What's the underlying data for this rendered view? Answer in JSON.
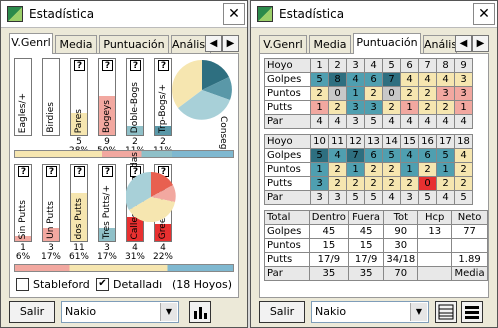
{
  "left": {
    "title": "Estadística",
    "close": "✕",
    "tabs": [
      "V.Genrl",
      "Media",
      "Puntuación",
      "Análisis"
    ],
    "upper_bars": [
      {
        "label": "Eagles/+",
        "count": "",
        "pct": "",
        "level": 0
      },
      {
        "label": "Birdies",
        "count": "",
        "pct": "",
        "level": 0
      },
      {
        "label": "Pares",
        "count": "5",
        "pct": "28%",
        "level": 0.28,
        "color": "#f6e6b0"
      },
      {
        "label": "Bogeys",
        "count": "9",
        "pct": "50%",
        "level": 0.5,
        "color": "#f2a8a0"
      },
      {
        "label": "Doble-Bogs",
        "count": "2",
        "pct": "11%",
        "level": 0.11,
        "color": "#8fc0c8"
      },
      {
        "label": "Trp-Bogs/+",
        "count": "2",
        "pct": "11%",
        "level": 0.11,
        "color": "#5a98a8"
      }
    ],
    "upper_pie_label": "Conseguido",
    "lower_bars": [
      {
        "label": "Sin Putts",
        "count": "1",
        "pct": "6%",
        "level": 0.06,
        "color": "#f2a8a0"
      },
      {
        "label": "Un Putts",
        "count": "3",
        "pct": "17%",
        "level": 0.17,
        "color": "#f2a8a0"
      },
      {
        "label": "dos Putts",
        "count": "11",
        "pct": "61%",
        "level": 0.61,
        "color": "#f6e6b0"
      },
      {
        "label": "Tres Putts/+",
        "count": "3",
        "pct": "17%",
        "level": 0.17,
        "color": "#8fc0c8"
      },
      {
        "label": "Calles Conseguidas",
        "count": "4",
        "pct": "31%",
        "level": 0.31,
        "color": "#e83030"
      },
      {
        "label": "Green en Reg.",
        "count": "4",
        "pct": "22%",
        "level": 0.22,
        "color": "#e83030"
      }
    ],
    "stableford_label": "Stableford",
    "detallado_label": "Detalladı",
    "hoyos_label": "(18 Hoyos)",
    "salir": "Salir",
    "player": "Nakio"
  },
  "right": {
    "title": "Estadística",
    "close": "✕",
    "tabs": [
      "V.Genrl",
      "Media",
      "Puntuación",
      "Análisis"
    ],
    "front": {
      "rows": [
        {
          "label": "Hoyo",
          "values": [
            "1",
            "2",
            "3",
            "4",
            "5",
            "6",
            "7",
            "8",
            "9"
          ]
        },
        {
          "label": "Golpes",
          "values": [
            "5",
            "8",
            "4",
            "6",
            "7",
            "4",
            "4",
            "4",
            "3"
          ]
        },
        {
          "label": "Puntos",
          "values": [
            "2",
            "0",
            "1",
            "2",
            "0",
            "2",
            "2",
            "3",
            "3"
          ]
        },
        {
          "label": "Putts",
          "values": [
            "1",
            "2",
            "3",
            "3",
            "2",
            "1",
            "2",
            "2",
            "1"
          ]
        },
        {
          "label": "Par",
          "values": [
            "4",
            "4",
            "3",
            "5",
            "4",
            "4",
            "4",
            "4",
            "4"
          ]
        }
      ]
    },
    "back": {
      "rows": [
        {
          "label": "Hoyo",
          "values": [
            "10",
            "11",
            "12",
            "13",
            "14",
            "15",
            "16",
            "17",
            "18"
          ]
        },
        {
          "label": "Golpes",
          "values": [
            "5",
            "4",
            "7",
            "6",
            "5",
            "4",
            "6",
            "5",
            "4"
          ]
        },
        {
          "label": "Puntos",
          "values": [
            "1",
            "2",
            "1",
            "2",
            "2",
            "1",
            "2",
            "1",
            "2"
          ]
        },
        {
          "label": "Putts",
          "values": [
            "3",
            "2",
            "2",
            "2",
            "2",
            "2",
            "0",
            "2",
            "2"
          ]
        },
        {
          "label": "Par",
          "values": [
            "3",
            "3",
            "5",
            "5",
            "4",
            "3",
            "5",
            "4",
            "5"
          ]
        }
      ]
    },
    "summary": {
      "header": [
        "Total",
        "Dentro",
        "Fuera",
        "Tot",
        "Hcp",
        "Neto"
      ],
      "rows": [
        {
          "label": "Golpes",
          "values": [
            "45",
            "45",
            "90",
            "13",
            "77"
          ]
        },
        {
          "label": "Puntos",
          "values": [
            "15",
            "15",
            "30",
            "",
            ""
          ]
        },
        {
          "label": "Putts",
          "values": [
            "17/9",
            "17/9",
            "34/18",
            "",
            "1.89"
          ]
        },
        {
          "label": "Par",
          "values": [
            "35",
            "35",
            "70",
            "",
            "Media"
          ]
        }
      ]
    },
    "salir": "Salir",
    "player": "Nakio"
  },
  "colors": {
    "score_blue": "#4f9fb0",
    "score_dark": "#2e6f80",
    "score_yellow": "#f6e6b0",
    "score_pink": "#f2a8a0",
    "score_red": "#e83030",
    "score_grey": "#c8c8c8",
    "accent_bar": "#7fb8d0"
  }
}
